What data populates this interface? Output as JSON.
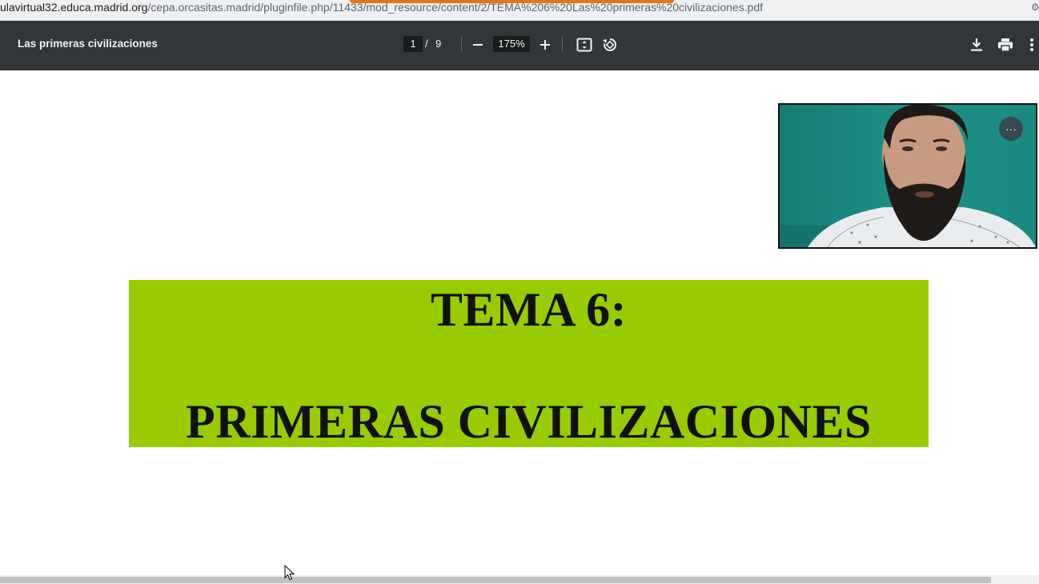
{
  "browser": {
    "url_host": "ulavirtual32.educa.madrid.org",
    "url_path": "/cepa.orcasitas.madrid/pluginfile.php/11433/mod_resource/content/2/TEMA%206%20Las%20primeras%20civilizaciones.pdf"
  },
  "pdf_toolbar": {
    "title": "Las primeras civilizaciones",
    "current_page": "1",
    "page_separator": "/",
    "total_pages": "9",
    "zoom": "175%",
    "icons": [
      "zoom-out-icon",
      "zoom-in-icon",
      "fit-page-icon",
      "rotate-icon",
      "download-icon",
      "print-icon",
      "more-vert-icon"
    ]
  },
  "document": {
    "banner_line1": "TEMA 6:",
    "banner_line2": "PRIMERAS CIVILIZACIONES",
    "banner_color": "#99cc00"
  },
  "video_overlay": {
    "more_label": "···",
    "background_color": "#1f8f86"
  },
  "colors": {
    "toolbar_bg": "#323639",
    "loading_bar": "#e8711a"
  }
}
